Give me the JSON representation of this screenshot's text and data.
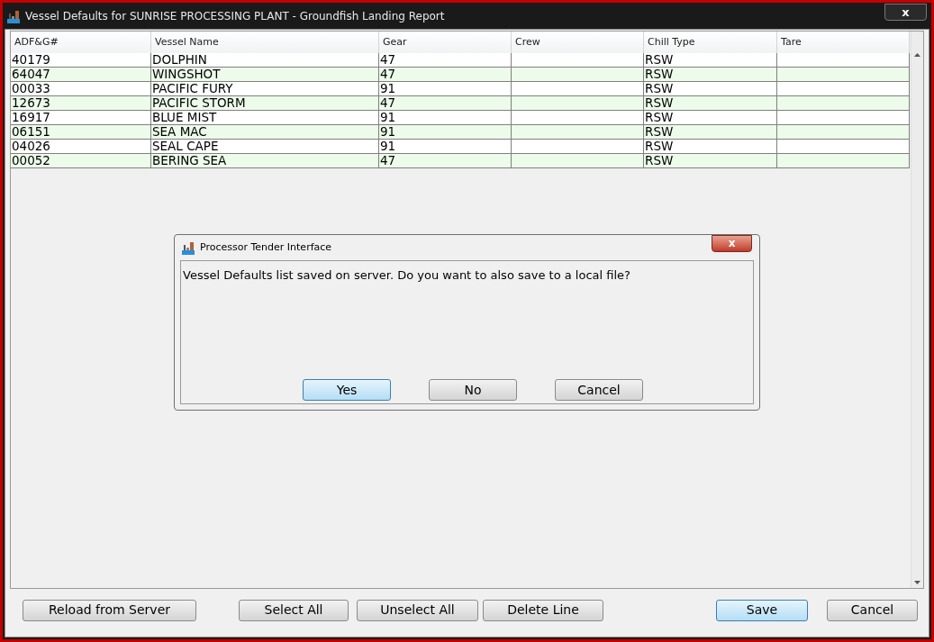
{
  "window": {
    "title": "Vessel Defaults for SUNRISE PROCESSING PLANT - Groundfish Landing Report",
    "close": "x"
  },
  "table": {
    "columns": [
      "ADF&G#",
      "Vessel Name",
      "Gear",
      "Crew",
      "Chill Type",
      "Tare"
    ],
    "rows": [
      [
        "40179",
        "DOLPHIN",
        "47",
        "",
        "RSW",
        ""
      ],
      [
        "64047",
        "WINGSHOT",
        "47",
        "",
        "RSW",
        ""
      ],
      [
        "00033",
        "PACIFIC FURY",
        "91",
        "",
        "RSW",
        ""
      ],
      [
        "12673",
        "PACIFIC STORM",
        "47",
        "",
        "RSW",
        ""
      ],
      [
        "16917",
        "BLUE MIST",
        "91",
        "",
        "RSW",
        ""
      ],
      [
        "06151",
        "SEA MAC",
        "91",
        "",
        "RSW",
        ""
      ],
      [
        "04026",
        "SEAL CAPE",
        "91",
        "",
        "RSW",
        ""
      ],
      [
        "00052",
        "BERING SEA",
        "47",
        "",
        "RSW",
        ""
      ]
    ]
  },
  "buttons": [
    {
      "label": "Reload from Server",
      "default": false
    },
    {
      "label": "Select All",
      "default": false
    },
    {
      "label": "Unselect All",
      "default": false
    },
    {
      "label": "Delete Line",
      "default": false
    },
    {
      "label": "Save",
      "default": true
    },
    {
      "label": "Cancel",
      "default": false
    }
  ],
  "dialog": {
    "title": "Processor Tender Interface",
    "close": "x",
    "message": "Vessel Defaults list saved on server. Do you want to also save to a local file?",
    "buttons": [
      {
        "label": "Yes",
        "default": true
      },
      {
        "label": "No",
        "default": false
      },
      {
        "label": "Cancel",
        "default": false
      }
    ]
  }
}
